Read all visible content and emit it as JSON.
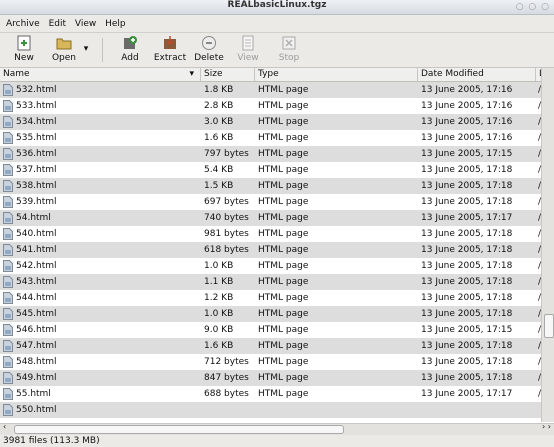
{
  "window": {
    "title": "REALbasicLinux.tgz"
  },
  "menu": [
    "Archive",
    "Edit",
    "View",
    "Help"
  ],
  "toolbar": {
    "new": "New",
    "open": "Open",
    "add": "Add",
    "extract": "Extract",
    "delete": "Delete",
    "view": "View",
    "stop": "Stop"
  },
  "columns": {
    "name": "Name",
    "size": "Size",
    "type": "Type",
    "date": "Date Modified",
    "location": "L"
  },
  "files": [
    {
      "name": "532.html",
      "size": "1.8 KB",
      "type": "HTML page",
      "date": "13 June 2005, 17:16",
      "loc": "/"
    },
    {
      "name": "533.html",
      "size": "2.8 KB",
      "type": "HTML page",
      "date": "13 June 2005, 17:16",
      "loc": "/"
    },
    {
      "name": "534.html",
      "size": "3.0 KB",
      "type": "HTML page",
      "date": "13 June 2005, 17:16",
      "loc": "/"
    },
    {
      "name": "535.html",
      "size": "1.6 KB",
      "type": "HTML page",
      "date": "13 June 2005, 17:16",
      "loc": "/"
    },
    {
      "name": "536.html",
      "size": "797 bytes",
      "type": "HTML page",
      "date": "13 June 2005, 17:15",
      "loc": "/"
    },
    {
      "name": "537.html",
      "size": "5.4 KB",
      "type": "HTML page",
      "date": "13 June 2005, 17:18",
      "loc": "/"
    },
    {
      "name": "538.html",
      "size": "1.5 KB",
      "type": "HTML page",
      "date": "13 June 2005, 17:18",
      "loc": "/"
    },
    {
      "name": "539.html",
      "size": "697 bytes",
      "type": "HTML page",
      "date": "13 June 2005, 17:18",
      "loc": "/"
    },
    {
      "name": "54.html",
      "size": "740 bytes",
      "type": "HTML page",
      "date": "13 June 2005, 17:17",
      "loc": "/"
    },
    {
      "name": "540.html",
      "size": "981 bytes",
      "type": "HTML page",
      "date": "13 June 2005, 17:18",
      "loc": "/"
    },
    {
      "name": "541.html",
      "size": "618 bytes",
      "type": "HTML page",
      "date": "13 June 2005, 17:18",
      "loc": "/"
    },
    {
      "name": "542.html",
      "size": "1.0 KB",
      "type": "HTML page",
      "date": "13 June 2005, 17:18",
      "loc": "/"
    },
    {
      "name": "543.html",
      "size": "1.1 KB",
      "type": "HTML page",
      "date": "13 June 2005, 17:18",
      "loc": "/"
    },
    {
      "name": "544.html",
      "size": "1.2 KB",
      "type": "HTML page",
      "date": "13 June 2005, 17:18",
      "loc": "/"
    },
    {
      "name": "545.html",
      "size": "1.0 KB",
      "type": "HTML page",
      "date": "13 June 2005, 17:18",
      "loc": "/"
    },
    {
      "name": "546.html",
      "size": "9.0 KB",
      "type": "HTML page",
      "date": "13 June 2005, 17:15",
      "loc": "/"
    },
    {
      "name": "547.html",
      "size": "1.6 KB",
      "type": "HTML page",
      "date": "13 June 2005, 17:18",
      "loc": "/"
    },
    {
      "name": "548.html",
      "size": "712 bytes",
      "type": "HTML page",
      "date": "13 June 2005, 17:18",
      "loc": "/"
    },
    {
      "name": "549.html",
      "size": "847 bytes",
      "type": "HTML page",
      "date": "13 June 2005, 17:18",
      "loc": "/"
    },
    {
      "name": "55.html",
      "size": "688 bytes",
      "type": "HTML page",
      "date": "13 June 2005, 17:17",
      "loc": "/"
    },
    {
      "name": "550.html",
      "size": "",
      "type": "",
      "date": "",
      "loc": ""
    }
  ],
  "status": "3981 files (113.3 MB)",
  "colors": {
    "alt_row": "#dddddd",
    "toolbar_bg": "#eceae6",
    "file_icon": "#b9c6d6"
  }
}
